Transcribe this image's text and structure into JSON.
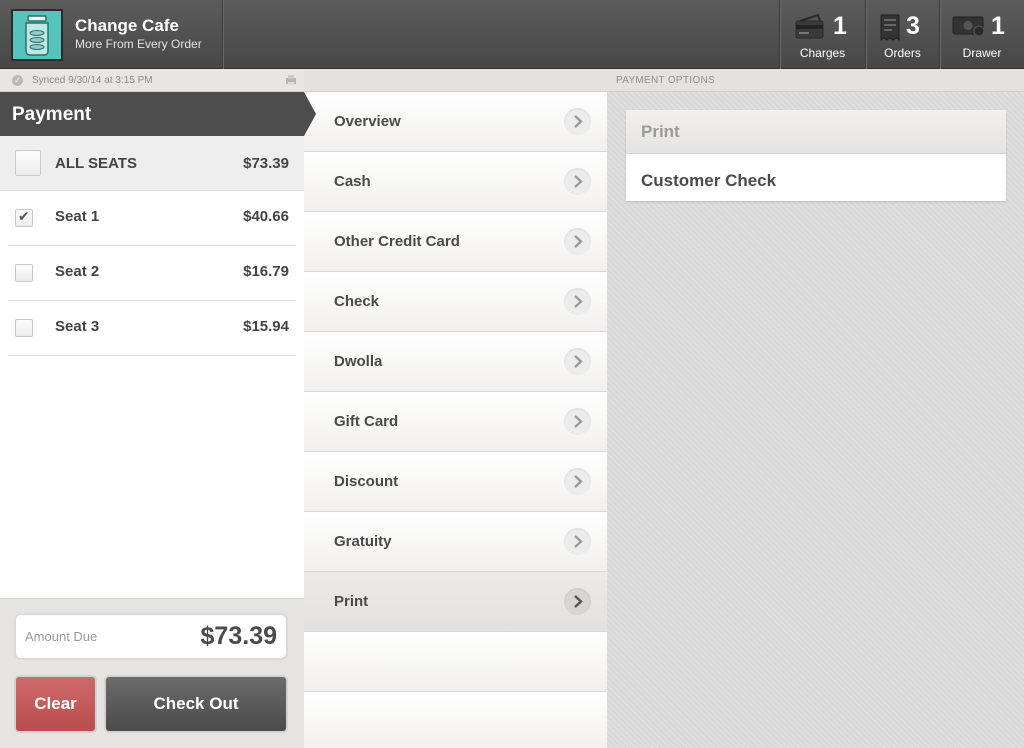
{
  "app": {
    "name": "Change Cafe",
    "tagline": "More From Every Order"
  },
  "stats": [
    {
      "icon": "credit-card-icon",
      "count": "1",
      "label": "Charges"
    },
    {
      "icon": "receipt-icon",
      "count": "3",
      "label": "Orders"
    },
    {
      "icon": "cash-drawer-icon",
      "count": "1",
      "label": "Drawer"
    }
  ],
  "sync": {
    "text": "Synced 9/30/14 at 3:15 PM"
  },
  "section_title": "PAYMENT OPTIONS",
  "payment": {
    "title": "Payment",
    "all_seats": {
      "label": "ALL SEATS",
      "amount": "$73.39",
      "checked": false
    },
    "seats": [
      {
        "label": "Seat 1",
        "amount": "$40.66",
        "checked": true
      },
      {
        "label": "Seat 2",
        "amount": "$16.79",
        "checked": false
      },
      {
        "label": "Seat 3",
        "amount": "$15.94",
        "checked": false
      }
    ],
    "amount_due_label": "Amount Due",
    "amount_due_value": "$73.39",
    "clear_label": "Clear",
    "checkout_label": "Check Out"
  },
  "menu": {
    "items": [
      "Overview",
      "Cash",
      "Other Credit Card",
      "Check",
      "Dwolla",
      "Gift Card",
      "Discount",
      "Gratuity",
      "Print"
    ],
    "active": "Print"
  },
  "print_panel": {
    "title": "Print",
    "items": [
      "Customer Check"
    ]
  },
  "colors": {
    "topbar": "#4f4f4f",
    "logo_bg": "#57c3bd",
    "clear_button": "#c25a5a",
    "checkout_button": "#555555"
  }
}
